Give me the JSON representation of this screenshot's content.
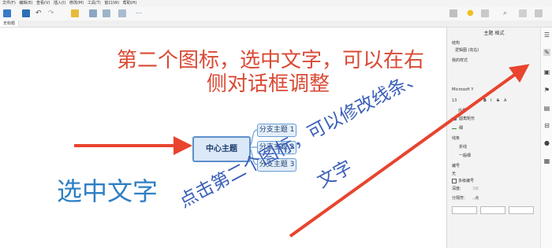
{
  "menu": [
    "文件(F)",
    "编辑(E)",
    "查看(V)",
    "插入(I)",
    "修改(M)",
    "工具(T)",
    "窗口(W)",
    "帮助(H)"
  ],
  "tab_label": "无标题",
  "panel": {
    "title": "主题 格式",
    "structure": "结构",
    "structure_value": "逻辑图 (向右)",
    "my_style": "我的样式",
    "font": "Microsoft Y",
    "font_size": "13",
    "font_buttons": [
      "B",
      "I",
      "S",
      "A"
    ],
    "border": "外框",
    "shape": "圆角矩形",
    "line_label": "线",
    "line_width": "细",
    "branch": "线条",
    "branch_style": "折线",
    "branch_width": "一般细",
    "numbering": "编号",
    "numbering_value": "无",
    "multi_numbering": "多级编号",
    "depth": "深度:",
    "depth_value": "3级",
    "separator": "分隔符:",
    "separator_value": "..点"
  },
  "mindmap": {
    "central": "中心主题",
    "branches": [
      "分支主题 1",
      "分支主题 2",
      "分支主题 3"
    ]
  },
  "annotations": {
    "top_line1": "第二个图标，选中文字，可以在右",
    "top_line2": "侧对话框调整",
    "left": "选中文字",
    "diagonal_line1": "点击第二个图标，可以修改线条、",
    "diagonal_line2": "文字"
  },
  "colors": {
    "annotation_red": "#d94a35",
    "annotation_blue": "#2f7fc4",
    "diagonal_blue": "#3a5fb8",
    "arrow_red": "#e8442e"
  }
}
